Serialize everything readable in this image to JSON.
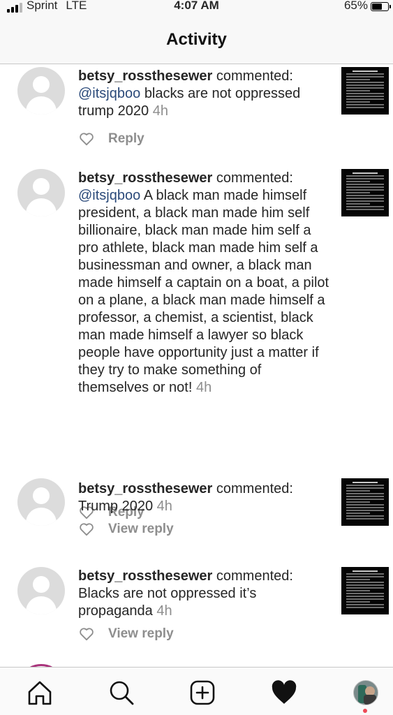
{
  "status_bar": {
    "carrier": "Sprint",
    "network": "LTE",
    "time": "4:07 AM",
    "battery": "65%",
    "battery_level": 0.65
  },
  "header": {
    "title": "Activity"
  },
  "comments": [
    {
      "username": "betsy_rossthesewer",
      "action": "commented:",
      "mention": "@itsjqboo",
      "text": "blacks are not oppressed trump 2020",
      "time": "4h",
      "button": "Reply",
      "thumbnail_icon": "dark-text-screenshot-thumbnail"
    },
    {
      "username": "betsy_rossthesewer",
      "action": "commented:",
      "mention": "@itsjqboo",
      "text": "A black man made himself president, a black man made him self billionaire, black man made him self a pro athlete, black man made him self a businessman and owner, a black man made himself a captain on a boat, a pilot on a plane, a black man made himself a professor, a chemist, a scientist, black man made himself a lawyer so black people have opportunity just a matter if they try to make something of themselves or not!",
      "time": "4h",
      "button": "Reply",
      "thumbnail_icon": "dark-text-screenshot-thumbnail"
    },
    {
      "username": "betsy_rossthesewer",
      "action": "commented:",
      "mention": "",
      "text": "Trump 2020",
      "time": "4h",
      "button": "View reply",
      "thumbnail_icon": "dark-text-screenshot-thumbnail"
    },
    {
      "username": "betsy_rossthesewer",
      "action": "commented:",
      "mention": "",
      "text": "Blacks are not oppressed it’s propaganda",
      "time": "4h",
      "button": "View reply",
      "thumbnail_icon": "dark-text-screenshot-thumbnail"
    }
  ],
  "tabbar": {
    "items": [
      "home-icon",
      "search-icon",
      "new-post-icon",
      "activity-heart-icon",
      "profile-avatar"
    ],
    "notification_dot_color": "#ed4956"
  },
  "colors": {
    "text": "#262626",
    "secondary": "#8e8e8e",
    "mention": "#2b4a7a"
  }
}
